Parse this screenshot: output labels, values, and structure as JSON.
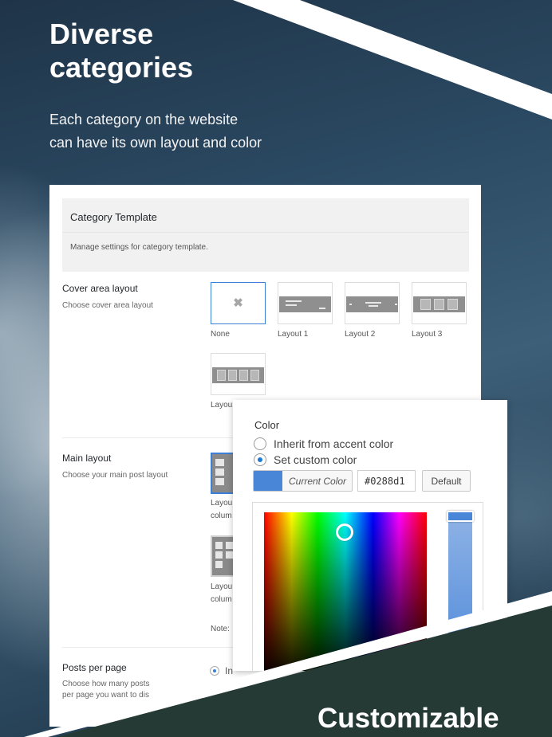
{
  "hero": {
    "title_lines": [
      "Diverse",
      "categories"
    ],
    "subtitle_lines": [
      "Each category on the website",
      "can have its own layout and color"
    ]
  },
  "panel": {
    "title": "Category Template",
    "description": "Manage settings for category template.",
    "cover": {
      "label": "Cover area layout",
      "description": "Choose cover area layout",
      "options": [
        "None",
        "Layout 1",
        "Layout 2",
        "Layout 3",
        "Layou"
      ],
      "selected": "None"
    },
    "main": {
      "label": "Main layout",
      "description": "Choose your main post layout",
      "options": [
        {
          "line1": "Layou",
          "line2": "colum"
        },
        {
          "line1": "Layou",
          "line2": "colum"
        }
      ],
      "note": "Note:"
    },
    "posts": {
      "label": "Posts per page",
      "description_lines": [
        "Choose how many posts",
        "per page you want to dis"
      ],
      "radio_label": "In"
    }
  },
  "color_popup": {
    "label": "Color",
    "options": [
      "Inherit from accent color",
      "Set custom color"
    ],
    "selected": "Set custom color",
    "current_color_label": "Current Color",
    "hex_value": "#0288d1",
    "default_label": "Default",
    "swatch_color": "#4a86d8"
  },
  "footer": {
    "title": "Customizable"
  }
}
